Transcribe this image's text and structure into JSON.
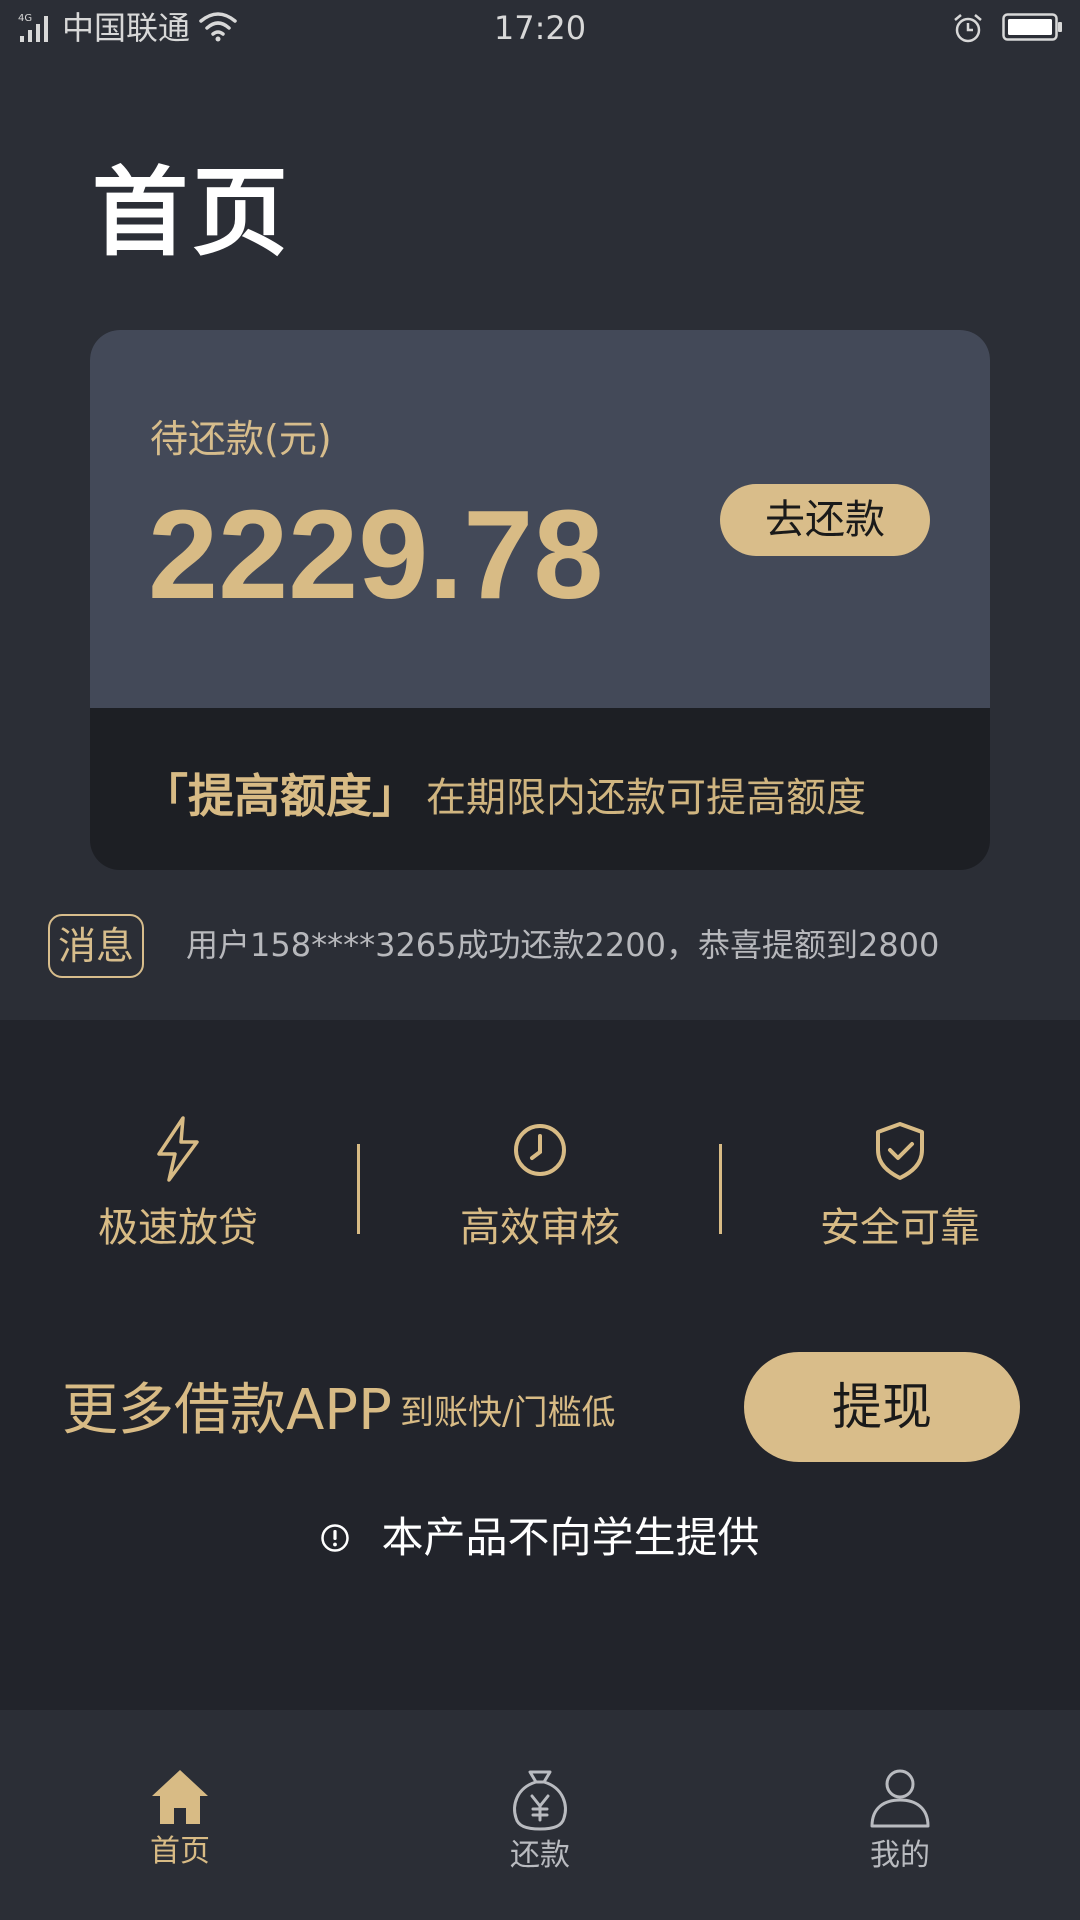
{
  "status_bar": {
    "network": "4G",
    "carrier": "中国联通",
    "time": "17:20"
  },
  "header": {
    "title": "首页"
  },
  "card": {
    "label": "待还款(元)",
    "amount": "2229.78",
    "repay_button": "去还款",
    "promo_bold": "「提高额度」",
    "promo_text": "在期限内还款可提高额度"
  },
  "message": {
    "badge": "消息",
    "text": "用户158****3265成功还款2200，恭喜提额到2800"
  },
  "features": [
    {
      "label": "极速放贷",
      "icon": "lightning-icon"
    },
    {
      "label": "高效审核",
      "icon": "clock-icon"
    },
    {
      "label": "安全可靠",
      "icon": "shield-check-icon"
    }
  ],
  "promo": {
    "title": "更多借款APP",
    "subtitle": "到账快/门槛低",
    "button": "提现"
  },
  "notice": {
    "text": "本产品不向学生提供",
    "icon": "exclamation-circle-icon"
  },
  "tabs": [
    {
      "label": "首页",
      "icon": "home-icon",
      "active": true
    },
    {
      "label": "还款",
      "icon": "money-bag-icon",
      "active": false
    },
    {
      "label": "我的",
      "icon": "user-icon",
      "active": false
    }
  ],
  "colors": {
    "accent": "#d8bb85",
    "background": "#2b2e36",
    "card": "#434958",
    "inactive_tab": "#b9bbc0"
  }
}
